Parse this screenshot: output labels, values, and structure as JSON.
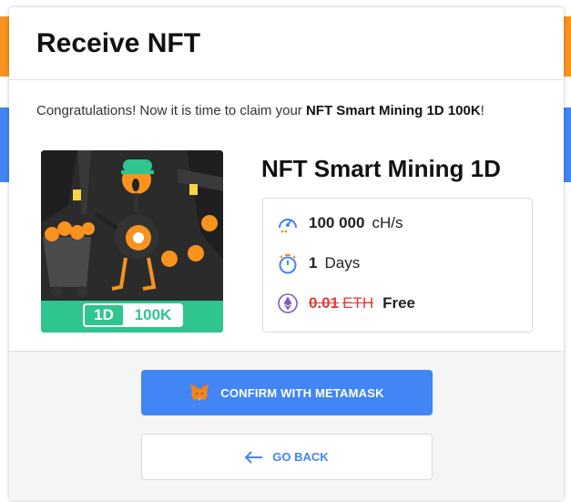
{
  "colors": {
    "accent_blue": "#4285f4",
    "accent_orange": "#f7931e",
    "nft_green": "#2ec58f",
    "strike_red": "#e23c3c"
  },
  "modal": {
    "title": "Receive NFT",
    "congrats_prefix": "Congratulations! Now it is time to claim your ",
    "congrats_highlight": "NFT Smart Mining 1D 100K",
    "congrats_suffix": "!"
  },
  "nft": {
    "image_icon": "miner-robot-illustration",
    "badge_duration": "1D",
    "badge_power": "100K",
    "name": "NFT Smart Mining 1D"
  },
  "specs": {
    "hashrate_value": "100 000",
    "hashrate_unit": "cH/s",
    "hashrate_icon": "speedometer-icon",
    "duration_value": "1",
    "duration_unit": "Days",
    "duration_icon": "stopwatch-icon",
    "price_old_value": "0.01",
    "price_old_unit": "ETH",
    "price_new": "Free",
    "price_icon": "ethereum-icon"
  },
  "footer": {
    "confirm_label": "CONFIRM WITH METAMASK",
    "confirm_icon": "metamask-fox-icon",
    "back_label": "GO BACK",
    "back_icon": "arrow-left-icon"
  }
}
